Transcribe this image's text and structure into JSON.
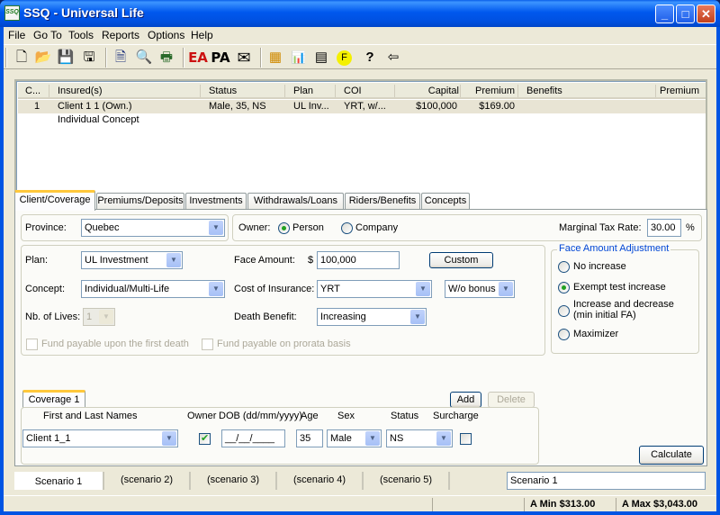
{
  "window": {
    "title": "SSQ - Universal Life",
    "app_icon_text": "SSQ",
    "controls": {
      "minimize": "_",
      "maximize": "□",
      "close": "✕"
    }
  },
  "menu": [
    "File",
    "Go To",
    "Tools",
    "Reports",
    "Options",
    "Help"
  ],
  "toolbar": [
    {
      "name": "new-document-icon",
      "glyph": "🗋"
    },
    {
      "name": "open-folder-icon",
      "glyph": "📂"
    },
    {
      "name": "save-icon",
      "glyph": "💾"
    },
    {
      "name": "save-as-icon",
      "glyph": "🖫"
    },
    {
      "name": "document-icon",
      "glyph": "🗎"
    },
    {
      "name": "print-preview-icon",
      "glyph": "🔍"
    },
    {
      "name": "print-icon",
      "glyph": "🖶"
    },
    {
      "name": "ea-icon",
      "glyph": "EA"
    },
    {
      "name": "pa-icon",
      "glyph": "PA"
    },
    {
      "name": "email-icon",
      "glyph": "✉"
    },
    {
      "name": "table-icon",
      "glyph": "▦"
    },
    {
      "name": "chart-icon",
      "glyph": "📊"
    },
    {
      "name": "calculator-icon",
      "glyph": "▤"
    },
    {
      "name": "f-icon",
      "glyph": "F"
    },
    {
      "name": "help-icon",
      "glyph": "?"
    },
    {
      "name": "back-arrow-icon",
      "glyph": "⇦"
    }
  ],
  "list": {
    "columns": [
      "C...",
      "Insured(s)",
      "Status",
      "Plan",
      "COI",
      "Capital",
      "Premium",
      "Benefits",
      "Premium"
    ],
    "rows": [
      {
        "c": "1",
        "insured": "Client 1 1 (Own.)",
        "status": "Male, 35, NS",
        "plan": "UL Inv...",
        "coi": "YRT, w/...",
        "capital": "$100,000",
        "premium": "$169.00",
        "benefits": "",
        "premium2": ""
      },
      {
        "c": "",
        "insured": "Individual Concept",
        "status": "",
        "plan": "",
        "coi": "",
        "capital": "",
        "premium": "",
        "benefits": "",
        "premium2": ""
      }
    ]
  },
  "tabs": [
    "Client/Coverage",
    "Premiums/Deposits",
    "Investments",
    "Withdrawals/Loans",
    "Riders/Benefits",
    "Concepts"
  ],
  "client": {
    "province_label": "Province:",
    "province_value": "Quebec",
    "owner_label": "Owner:",
    "owner_options": [
      {
        "label": "Person",
        "selected": true
      },
      {
        "label": "Company",
        "selected": false
      }
    ],
    "tax_rate_label": "Marginal Tax Rate:",
    "tax_rate_value": "30.00",
    "tax_rate_unit": "%",
    "plan_label": "Plan:",
    "plan_value": "UL Investment",
    "concept_label": "Concept:",
    "concept_value": "Individual/Multi-Life",
    "lives_label": "Nb. of Lives:",
    "lives_value": "1",
    "face_amount_label": "Face Amount:",
    "face_amount_currency": "$",
    "face_amount_value": "100,000",
    "custom_button": "Custom",
    "coi_label": "Cost of Insurance:",
    "coi_value": "YRT",
    "bonus_value": "W/o bonus",
    "death_benefit_label": "Death Benefit:",
    "death_benefit_value": "Increasing",
    "fund_first_death": "Fund payable upon the first death",
    "fund_prorata": "Fund payable on prorata basis",
    "face_adjust": {
      "title": "Face Amount Adjustment",
      "options": [
        {
          "label": "No increase",
          "selected": false
        },
        {
          "label": "Exempt test increase",
          "selected": true
        },
        {
          "label": "Increase and decrease",
          "label2": "(min initial FA)",
          "selected": false
        },
        {
          "label": "Maximizer",
          "selected": false
        }
      ]
    }
  },
  "coverage": {
    "tab_label": "Coverage 1",
    "add_button": "Add",
    "delete_button": "Delete",
    "headers": {
      "name": "First and Last Names",
      "owner": "Owner",
      "dob": "DOB (dd/mm/yyyy)",
      "age": "Age",
      "sex": "Sex",
      "status": "Status",
      "surcharge": "Surcharge"
    },
    "row": {
      "name": "Client 1_1",
      "owner": true,
      "dob": "__/__/____",
      "age": "35",
      "sex": "Male",
      "status": "NS",
      "surcharge": false
    }
  },
  "calculate_button": "Calculate",
  "scenarios": [
    "Scenario 1",
    "(scenario 2)",
    "(scenario 3)",
    "(scenario 4)",
    "(scenario 5)"
  ],
  "scenario_name_value": "Scenario 1",
  "status": {
    "min": "A Min $313.00",
    "max": "A Max $3,043.00"
  }
}
